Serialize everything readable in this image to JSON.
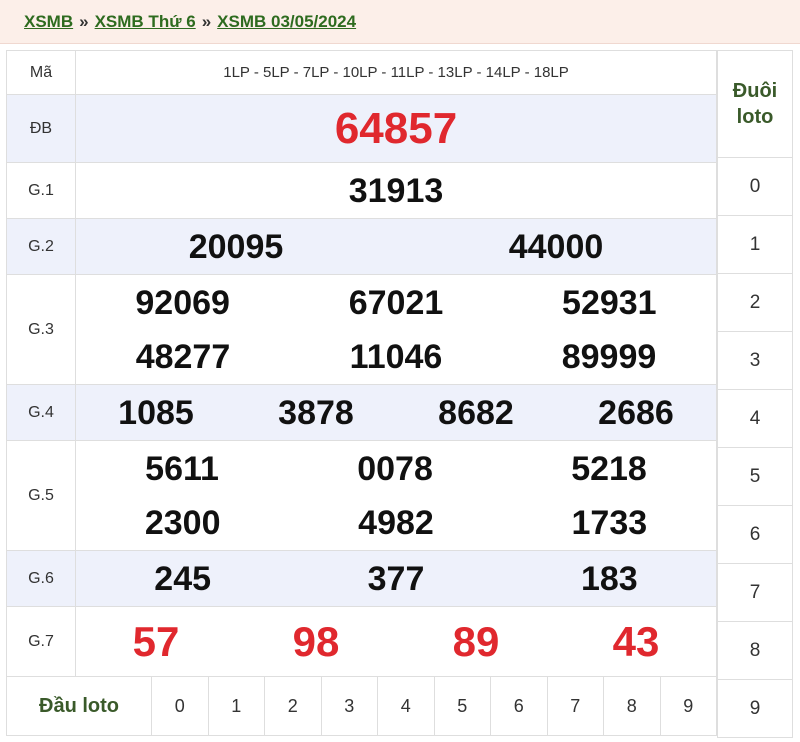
{
  "breadcrumb": {
    "items": [
      "XSMB",
      "XSMB Thứ 6",
      "XSMB 03/05/2024"
    ],
    "separator": "»"
  },
  "table": {
    "ma_label": "Mã",
    "ma_codes": "1LP - 5LP - 7LP - 10LP - 11LP - 13LP - 14LP - 18LP",
    "prizes": {
      "db": {
        "label": "ĐB",
        "numbers": [
          "64857"
        ]
      },
      "g1": {
        "label": "G.1",
        "numbers": [
          "31913"
        ]
      },
      "g2": {
        "label": "G.2",
        "numbers": [
          "20095",
          "44000"
        ]
      },
      "g3": {
        "label": "G.3",
        "numbers": [
          "92069",
          "67021",
          "52931",
          "48277",
          "11046",
          "89999"
        ]
      },
      "g4": {
        "label": "G.4",
        "numbers": [
          "1085",
          "3878",
          "8682",
          "2686"
        ]
      },
      "g5": {
        "label": "G.5",
        "numbers": [
          "5611",
          "0078",
          "5218",
          "2300",
          "4982",
          "1733"
        ]
      },
      "g6": {
        "label": "G.6",
        "numbers": [
          "245",
          "377",
          "183"
        ]
      },
      "g7": {
        "label": "G.7",
        "numbers": [
          "57",
          "98",
          "89",
          "43"
        ]
      }
    }
  },
  "dau_loto": {
    "label": "Đầu loto",
    "digits": [
      "0",
      "1",
      "2",
      "3",
      "4",
      "5",
      "6",
      "7",
      "8",
      "9"
    ]
  },
  "duoi_loto": {
    "label_line1": "Đuôi",
    "label_line2": "loto",
    "digits": [
      "0",
      "1",
      "2",
      "3",
      "4",
      "5",
      "6",
      "7",
      "8",
      "9"
    ]
  },
  "colors": {
    "accent_red": "#e0282e",
    "link_green": "#2e6b1f",
    "row_shade": "#eef1fb",
    "header_bg": "#fcefe9"
  }
}
